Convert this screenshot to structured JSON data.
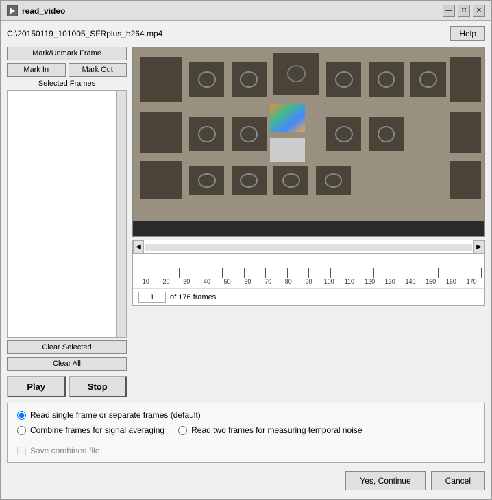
{
  "window": {
    "title": "read_video",
    "title_icon": "▶"
  },
  "header": {
    "file_path": "C:\\20150119_101005_SFRplus_h264.mp4",
    "help_label": "Help"
  },
  "left_panel": {
    "mark_unmark_label": "Mark/Unmark Frame",
    "mark_in_label": "Mark In",
    "mark_out_label": "Mark Out",
    "selected_frames_label": "Selected Frames",
    "clear_selected_label": "Clear Selected",
    "clear_all_label": "Clear All",
    "play_label": "Play",
    "stop_label": "Stop"
  },
  "timeline": {
    "frame_current": "1",
    "frame_total": "of 176 frames",
    "ruler_labels": [
      "10",
      "20",
      "30",
      "40",
      "50",
      "60",
      "70",
      "80",
      "90",
      "100",
      "110",
      "120",
      "130",
      "140",
      "150",
      "160",
      "170"
    ]
  },
  "options": {
    "radio1": "Read single frame or separate frames (default)",
    "radio2": "Combine frames for signal averaging",
    "radio3": "Read two frames for measuring temporal noise",
    "checkbox": "Save combined file"
  },
  "actions": {
    "yes_continue_label": "Yes, Continue",
    "cancel_label": "Cancel"
  }
}
